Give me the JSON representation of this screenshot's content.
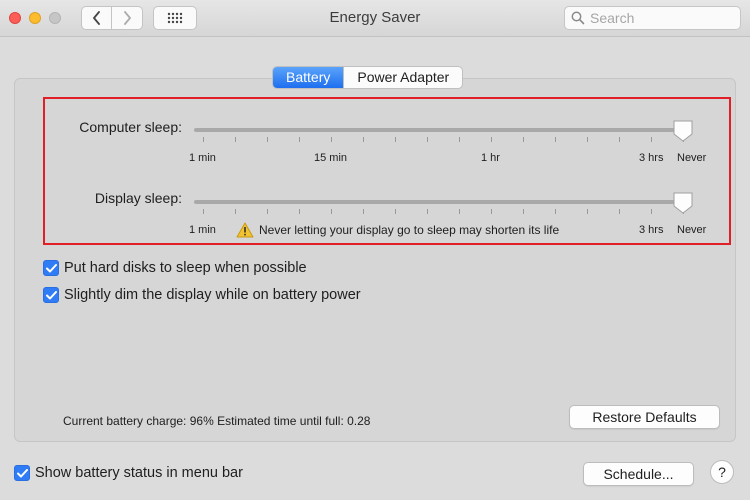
{
  "window": {
    "title": "Energy Saver"
  },
  "search": {
    "placeholder": "Search"
  },
  "tabs": [
    {
      "label": "Battery",
      "active": true
    },
    {
      "label": "Power Adapter",
      "active": false
    }
  ],
  "computer_sleep": {
    "label": "Computer sleep:",
    "ticks": [
      "1 min",
      "15 min",
      "1 hr",
      "3 hrs",
      "Never"
    ],
    "value": "Never"
  },
  "display_sleep": {
    "label": "Display sleep:",
    "ticks": [
      "1 min",
      "3 hrs",
      "Never"
    ],
    "value": "Never",
    "warning": "Never letting your display go to sleep may shorten its life"
  },
  "options": [
    {
      "label": "Put hard disks to sleep when possible",
      "checked": true
    },
    {
      "label": "Slightly dim the display while on battery power",
      "checked": true
    }
  ],
  "status": "Current battery charge: 96%  Estimated time until full: 0.28",
  "buttons": {
    "restore": "Restore Defaults",
    "schedule": "Schedule...",
    "help": "?"
  },
  "menu_bar_option": {
    "label": "Show battery status in menu bar",
    "checked": true
  },
  "colors": {
    "accent": "#2f7cf6",
    "highlight_border": "#e01f26"
  },
  "icons": [
    "back-icon",
    "forward-icon",
    "grid-icon",
    "search-icon",
    "warning-icon",
    "checkmark-icon"
  ]
}
